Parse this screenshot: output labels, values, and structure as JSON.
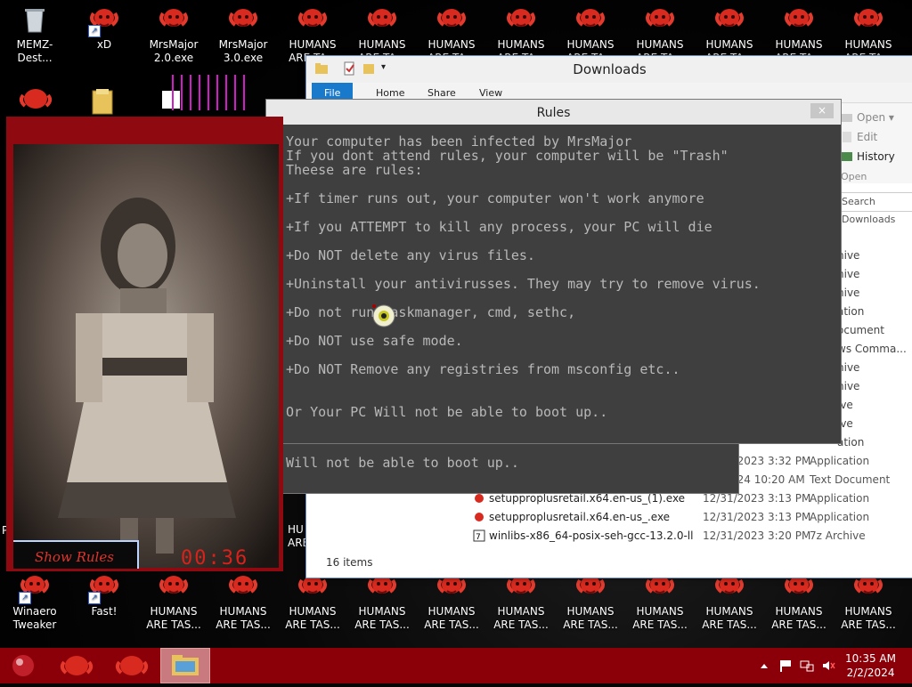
{
  "desktop": {
    "top_row": [
      {
        "label": "MEMZ-Dest...",
        "icon": "recycle-bin-icon",
        "shortcut": false
      },
      {
        "label": "xD",
        "icon": "ram-icon",
        "shortcut": true
      },
      {
        "label": "MrsMajor\n2.0.exe",
        "icon": "ram-icon",
        "shortcut": false
      },
      {
        "label": "MrsMajor\n3.0.exe",
        "icon": "ram-icon",
        "shortcut": false
      },
      {
        "label": "HUMANS\nARE TA...",
        "icon": "ram-icon",
        "shortcut": false
      },
      {
        "label": "HUMANS\nARE TA...",
        "icon": "ram-icon",
        "shortcut": false
      },
      {
        "label": "HUMANS\nARE TA...",
        "icon": "ram-icon",
        "shortcut": false
      },
      {
        "label": "HUMANS\nARE TA...",
        "icon": "ram-icon",
        "shortcut": false
      },
      {
        "label": "HUMANS\nARE TA...",
        "icon": "ram-icon",
        "shortcut": false
      },
      {
        "label": "HUMANS\nARE TA...",
        "icon": "ram-icon",
        "shortcut": false
      },
      {
        "label": "HUMANS\nARE TA...",
        "icon": "ram-icon",
        "shortcut": false
      },
      {
        "label": "HUMANS\nARE TA...",
        "icon": "ram-icon",
        "shortcut": false
      },
      {
        "label": "HUMANS\nARE TA...",
        "icon": "ram-icon",
        "shortcut": false
      }
    ],
    "bottom_row": [
      {
        "label": "Winaero\nTweaker",
        "shortcut": true
      },
      {
        "label": "Fast!",
        "shortcut": true
      },
      {
        "label": "HUMANS\nARE TAS..."
      },
      {
        "label": "HUMANS\nARE TAS..."
      },
      {
        "label": "HUMANS\nARE TAS..."
      },
      {
        "label": "HUMANS\nARE TAS..."
      },
      {
        "label": "HUMANS\nARE TAS..."
      },
      {
        "label": "HUMANS\nARE TAS..."
      },
      {
        "label": "HUMANS\nARE TAS..."
      },
      {
        "label": "HUMANS\nARE TAS..."
      },
      {
        "label": "HUMANS\nARE TAS..."
      },
      {
        "label": "HUMANS\nARE TAS..."
      },
      {
        "label": "HUMANS\nARE TAS..."
      }
    ],
    "side_labels": {
      "left_p": "P",
      "hu": "HU\nARE"
    }
  },
  "explorer": {
    "title": "Downloads",
    "tabs": {
      "file": "File",
      "home": "Home",
      "share": "Share",
      "view": "View"
    },
    "ribbon": {
      "open": "Open",
      "edit": "Edit",
      "history": "History",
      "group": "Open"
    },
    "search_placeholder": "Search Downloads",
    "types_partial": [
      "hive",
      "hive",
      "hive",
      "ation",
      "ocument",
      "ws Comma...",
      "hive",
      "hive",
      "ive",
      "ive",
      "ation"
    ],
    "files": [
      {
        "name": "",
        "date": "12/31/2023 3:32 PM",
        "type": "Application",
        "icon": "app-icon"
      },
      {
        "name": "",
        "date": "1/7/2024 10:20 AM",
        "type": "Text Document",
        "icon": "text-icon"
      },
      {
        "name": "setupproplusretail.x64.en-us_(1).exe",
        "date": "12/31/2023 3:13 PM",
        "type": "Application",
        "icon": "ram-icon"
      },
      {
        "name": "setupproplusretail.x64.en-us_.exe",
        "date": "12/31/2023 3:13 PM",
        "type": "Application",
        "icon": "ram-icon"
      },
      {
        "name": "winlibs-x86_64-posix-seh-gcc-13.2.0-llv...",
        "date": "12/31/2023 3:20 PM",
        "type": "7z Archive",
        "icon": "archive-icon"
      }
    ],
    "status": "16 items"
  },
  "rules": {
    "title": "Rules",
    "close": "×",
    "lines": [
      "Your computer has been infected by MrsMajor",
      "If you dont attend rules, your computer will be \"Trash\"",
      "Theese are rules:",
      "",
      "+If timer runs out, your computer won't work anymore",
      "",
      "+If you ATTEMPT to kill any process, your PC will die",
      "",
      "+Do NOT delete any virus files.",
      "",
      "+Uninstall your antivirusses. They may try to remove virus.",
      "",
      "+Do not run Taskmanager, cmd, sethc,",
      "",
      "+Do NOT use safe mode.",
      "",
      "+Do NOT Remove any registries from msconfig etc..",
      "",
      "",
      "Or Your PC Will not be able to boot up.."
    ],
    "echo_line": "Will not be able to boot up.."
  },
  "mrsmajor": {
    "button": "Show Rules",
    "timer": "00:36"
  },
  "taskbar": {
    "time": "10:35 AM",
    "date": "2/2/2024"
  },
  "colors": {
    "taskbar": "#8b0008",
    "popup_frame": "#8e0a10",
    "timer": "#d8221b",
    "rules_bg": "#3f3f3f",
    "rules_text": "#b8b8b8"
  }
}
